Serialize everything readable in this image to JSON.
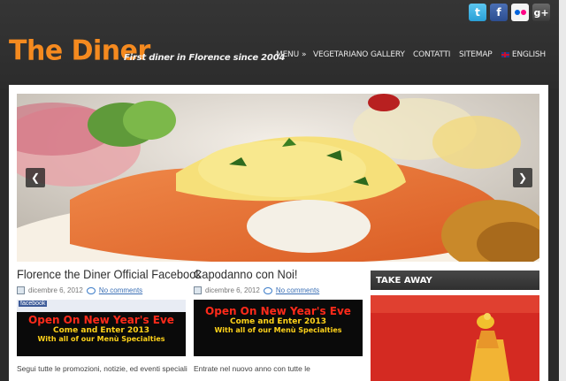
{
  "colors": {
    "brand": "#f58a1f",
    "header_bg": "#2f2f2f",
    "link": "#3a6fb5",
    "widget_title_bg": "#3a3a3a"
  },
  "social": [
    {
      "icon": "twitter-icon",
      "glyph": "t"
    },
    {
      "icon": "facebook-icon",
      "glyph": "f"
    },
    {
      "icon": "flickr-icon",
      "glyph": ""
    },
    {
      "icon": "google-plus-icon",
      "glyph": "g+"
    }
  ],
  "header": {
    "logo": "The Diner",
    "tagline": "First diner in Florence since 2004"
  },
  "nav": [
    {
      "label": "Menu",
      "suffix": "»"
    },
    {
      "label": "Vegetariano",
      "suffix": ""
    },
    {
      "label": "Gallery",
      "suffix": ""
    },
    {
      "label": "Contatti",
      "suffix": ""
    },
    {
      "label": "Sitemap",
      "suffix": ""
    },
    {
      "label": "English",
      "suffix": "",
      "flag": "uk-flag-icon"
    }
  ],
  "slider": {
    "prev_icon": "chevron-left-icon",
    "next_icon": "chevron-right-icon",
    "prev_glyph": "❮",
    "next_glyph": "❯"
  },
  "posts": [
    {
      "title": "Florence the Diner Official Facebook",
      "date": "dicembre 6, 2012",
      "comments": "No comments",
      "image_text_1": "Open On New Year's Eve",
      "image_text_2": "Come and Enter 2013",
      "image_text_3": "With all of our Menù Specialties",
      "image_header": "facebook",
      "excerpt": "Segui tutte le promozioni, notizie, ed eventi speciali"
    },
    {
      "title": "Capodanno con Noi!",
      "date": "dicembre 6, 2012",
      "comments": "No comments",
      "image_text_1": "Open On New Year's Eve",
      "image_text_2": "Come and Enter 2013",
      "image_text_3": "With all of our Menù Specialties",
      "excerpt": "Entrate nel nuovo anno con tutte le"
    }
  ],
  "sidebar": {
    "widget_title": "Take Away"
  }
}
